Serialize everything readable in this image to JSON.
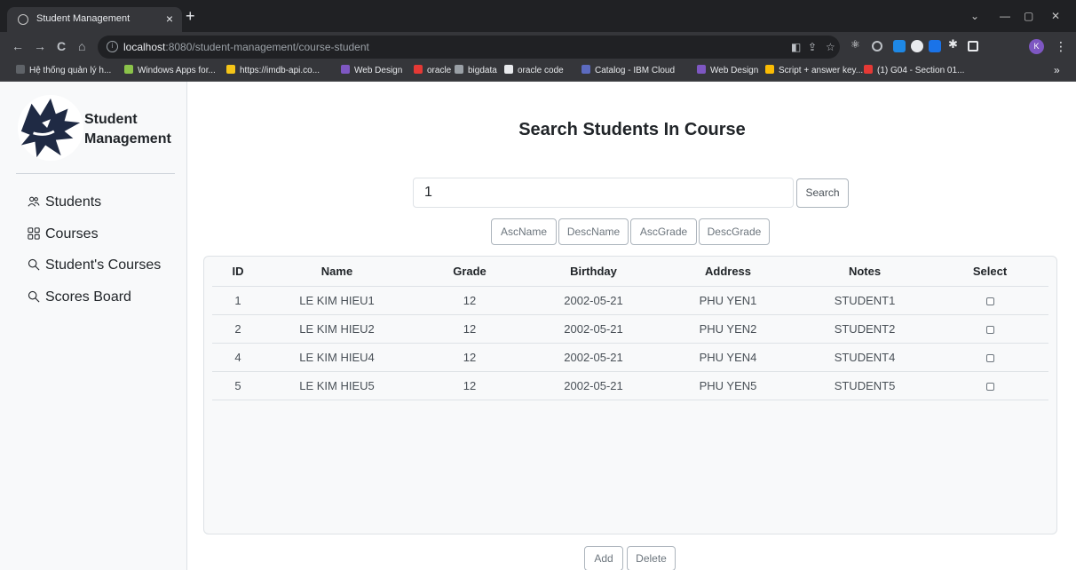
{
  "browser": {
    "tab_title": "Student Management",
    "tab_close": "×",
    "new_tab": "+",
    "window_controls": {
      "minimize": "—",
      "maximize": "▢",
      "close": "✕",
      "dropdown": "⌄"
    },
    "url_host": "localhost",
    "url_path": ":8080/student-management/course-student",
    "nav": {
      "back": "←",
      "forward": "→",
      "reload": "C",
      "home": "⌂"
    },
    "profile_initial": "K",
    "bookmarks": [
      {
        "label": "Hệ thống quản lý h...",
        "color": "#5f6368"
      },
      {
        "label": "Windows Apps for...",
        "color": "#8bc34a"
      },
      {
        "label": "https://imdb-api.co...",
        "color": "#f5c518"
      },
      {
        "label": "Web Design",
        "color": "#7e57c2"
      },
      {
        "label": "oracle",
        "color": "#e53935"
      },
      {
        "label": "bigdata",
        "color": "#9aa0a6"
      },
      {
        "label": "oracle code",
        "color": "#e8eaed"
      },
      {
        "label": "Catalog - IBM Cloud",
        "color": "#5c6bc0"
      },
      {
        "label": "Web Design",
        "color": "#7e57c2"
      },
      {
        "label": "Script + answer key...",
        "color": "#fbbc04"
      },
      {
        "label": "(1) G04 - Section 01...",
        "color": "#e53935"
      }
    ],
    "bookmarks_more": "»"
  },
  "sidebar": {
    "brand_line1": "Student",
    "brand_line2": "Management",
    "items": [
      {
        "label": "Students",
        "icon": "users-icon"
      },
      {
        "label": "Courses",
        "icon": "grid-icon"
      },
      {
        "label": "Student's Courses",
        "icon": "search-icon"
      },
      {
        "label": "Scores Board",
        "icon": "search-icon"
      }
    ]
  },
  "main": {
    "title": "Search Students In Course",
    "search_value": "1",
    "search_button": "Search",
    "sort_buttons": [
      "AscName",
      "DescName",
      "AscGrade",
      "DescGrade"
    ],
    "columns": [
      "ID",
      "Name",
      "Grade",
      "Birthday",
      "Address",
      "Notes",
      "Select"
    ],
    "rows": [
      {
        "id": "1",
        "name": "LE KIM HIEU1",
        "grade": "12",
        "birthday": "2002-05-21",
        "address": "PHU YEN1",
        "notes": "STUDENT1"
      },
      {
        "id": "2",
        "name": "LE KIM HIEU2",
        "grade": "12",
        "birthday": "2002-05-21",
        "address": "PHU YEN2",
        "notes": "STUDENT2"
      },
      {
        "id": "4",
        "name": "LE KIM HIEU4",
        "grade": "12",
        "birthday": "2002-05-21",
        "address": "PHU YEN4",
        "notes": "STUDENT4"
      },
      {
        "id": "5",
        "name": "LE KIM HIEU5",
        "grade": "12",
        "birthday": "2002-05-21",
        "address": "PHU YEN5",
        "notes": "STUDENT5"
      }
    ],
    "add_button": "Add",
    "delete_button": "Delete"
  }
}
